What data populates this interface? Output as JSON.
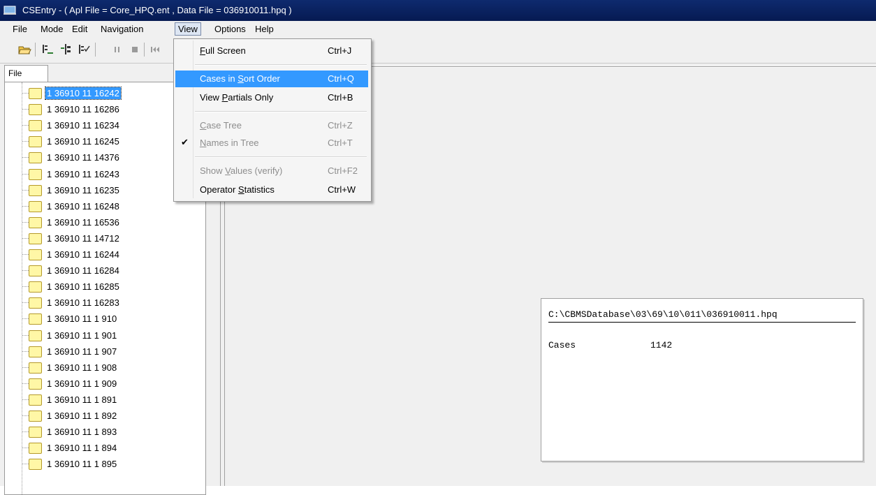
{
  "window": {
    "title": "CSEntry - ( Apl File = Core_HPQ.ent , Data File = 036910011.hpq )"
  },
  "menubar": [
    "File",
    "Mode",
    "Edit",
    "Navigation",
    "View",
    "Options",
    "Help"
  ],
  "toolbar": {
    "buttons": [
      "open-folder-icon",
      "insert-case-icon",
      "add-node-icon",
      "verify-case-icon",
      "pause-icon",
      "stop-icon",
      "first-record-icon"
    ]
  },
  "tree_panel": {
    "tab_label": "File",
    "items": [
      "1 36910 11 16242",
      "1 36910 11 16286",
      "1 36910 11 16234",
      "1 36910 11 16245",
      "1 36910 11 14376",
      "1 36910 11 16243",
      "1 36910 11 16235",
      "1 36910 11 16248",
      "1 36910 11 16536",
      "1 36910 11 14712",
      "1 36910 11 16244",
      "1 36910 11 16284",
      "1 36910 11 16285",
      "1 36910 11 16283",
      "1 36910 11 1 910",
      "1 36910 11 1 901",
      "1 36910 11 1 907",
      "1 36910 11 1 908",
      "1 36910 11 1 909",
      "1 36910 11 1 891",
      "1 36910 11 1 892",
      "1 36910 11 1 893",
      "1 36910 11 1 894",
      "1 36910 11 1 895"
    ],
    "selected_index": 0
  },
  "view_menu": {
    "items": [
      {
        "pre": "",
        "u": "F",
        "post": "ull Screen",
        "shortcut": "Ctrl+J",
        "enabled": true,
        "checked": false
      },
      {
        "pre": "Cases in ",
        "u": "S",
        "post": "ort Order",
        "shortcut": "Ctrl+Q",
        "enabled": true,
        "checked": false,
        "highlighted": true
      },
      {
        "pre": "View ",
        "u": "P",
        "post": "artials Only",
        "shortcut": "Ctrl+B",
        "enabled": true,
        "checked": false
      },
      {
        "pre": "",
        "u": "C",
        "post": "ase Tree",
        "shortcut": "Ctrl+Z",
        "enabled": false,
        "checked": false
      },
      {
        "pre": "",
        "u": "N",
        "post": "ames in Tree",
        "shortcut": "Ctrl+T",
        "enabled": false,
        "checked": true
      },
      {
        "pre": "Show ",
        "u": "V",
        "post": "alues (verify)",
        "shortcut": "Ctrl+F2",
        "enabled": false,
        "checked": false
      },
      {
        "pre": "Operator ",
        "u": "S",
        "post": "tatistics",
        "shortcut": "Ctrl+W",
        "enabled": true,
        "checked": false
      }
    ]
  },
  "info_panel": {
    "path": "C:\\CBMSDatabase\\03\\69\\10\\011\\036910011.hpq",
    "cases_label": "Cases",
    "cases_value": "1142"
  },
  "colors": {
    "titlebar": "#0e2a6e",
    "highlight": "#3399ff",
    "folder": "#fff7a6"
  }
}
